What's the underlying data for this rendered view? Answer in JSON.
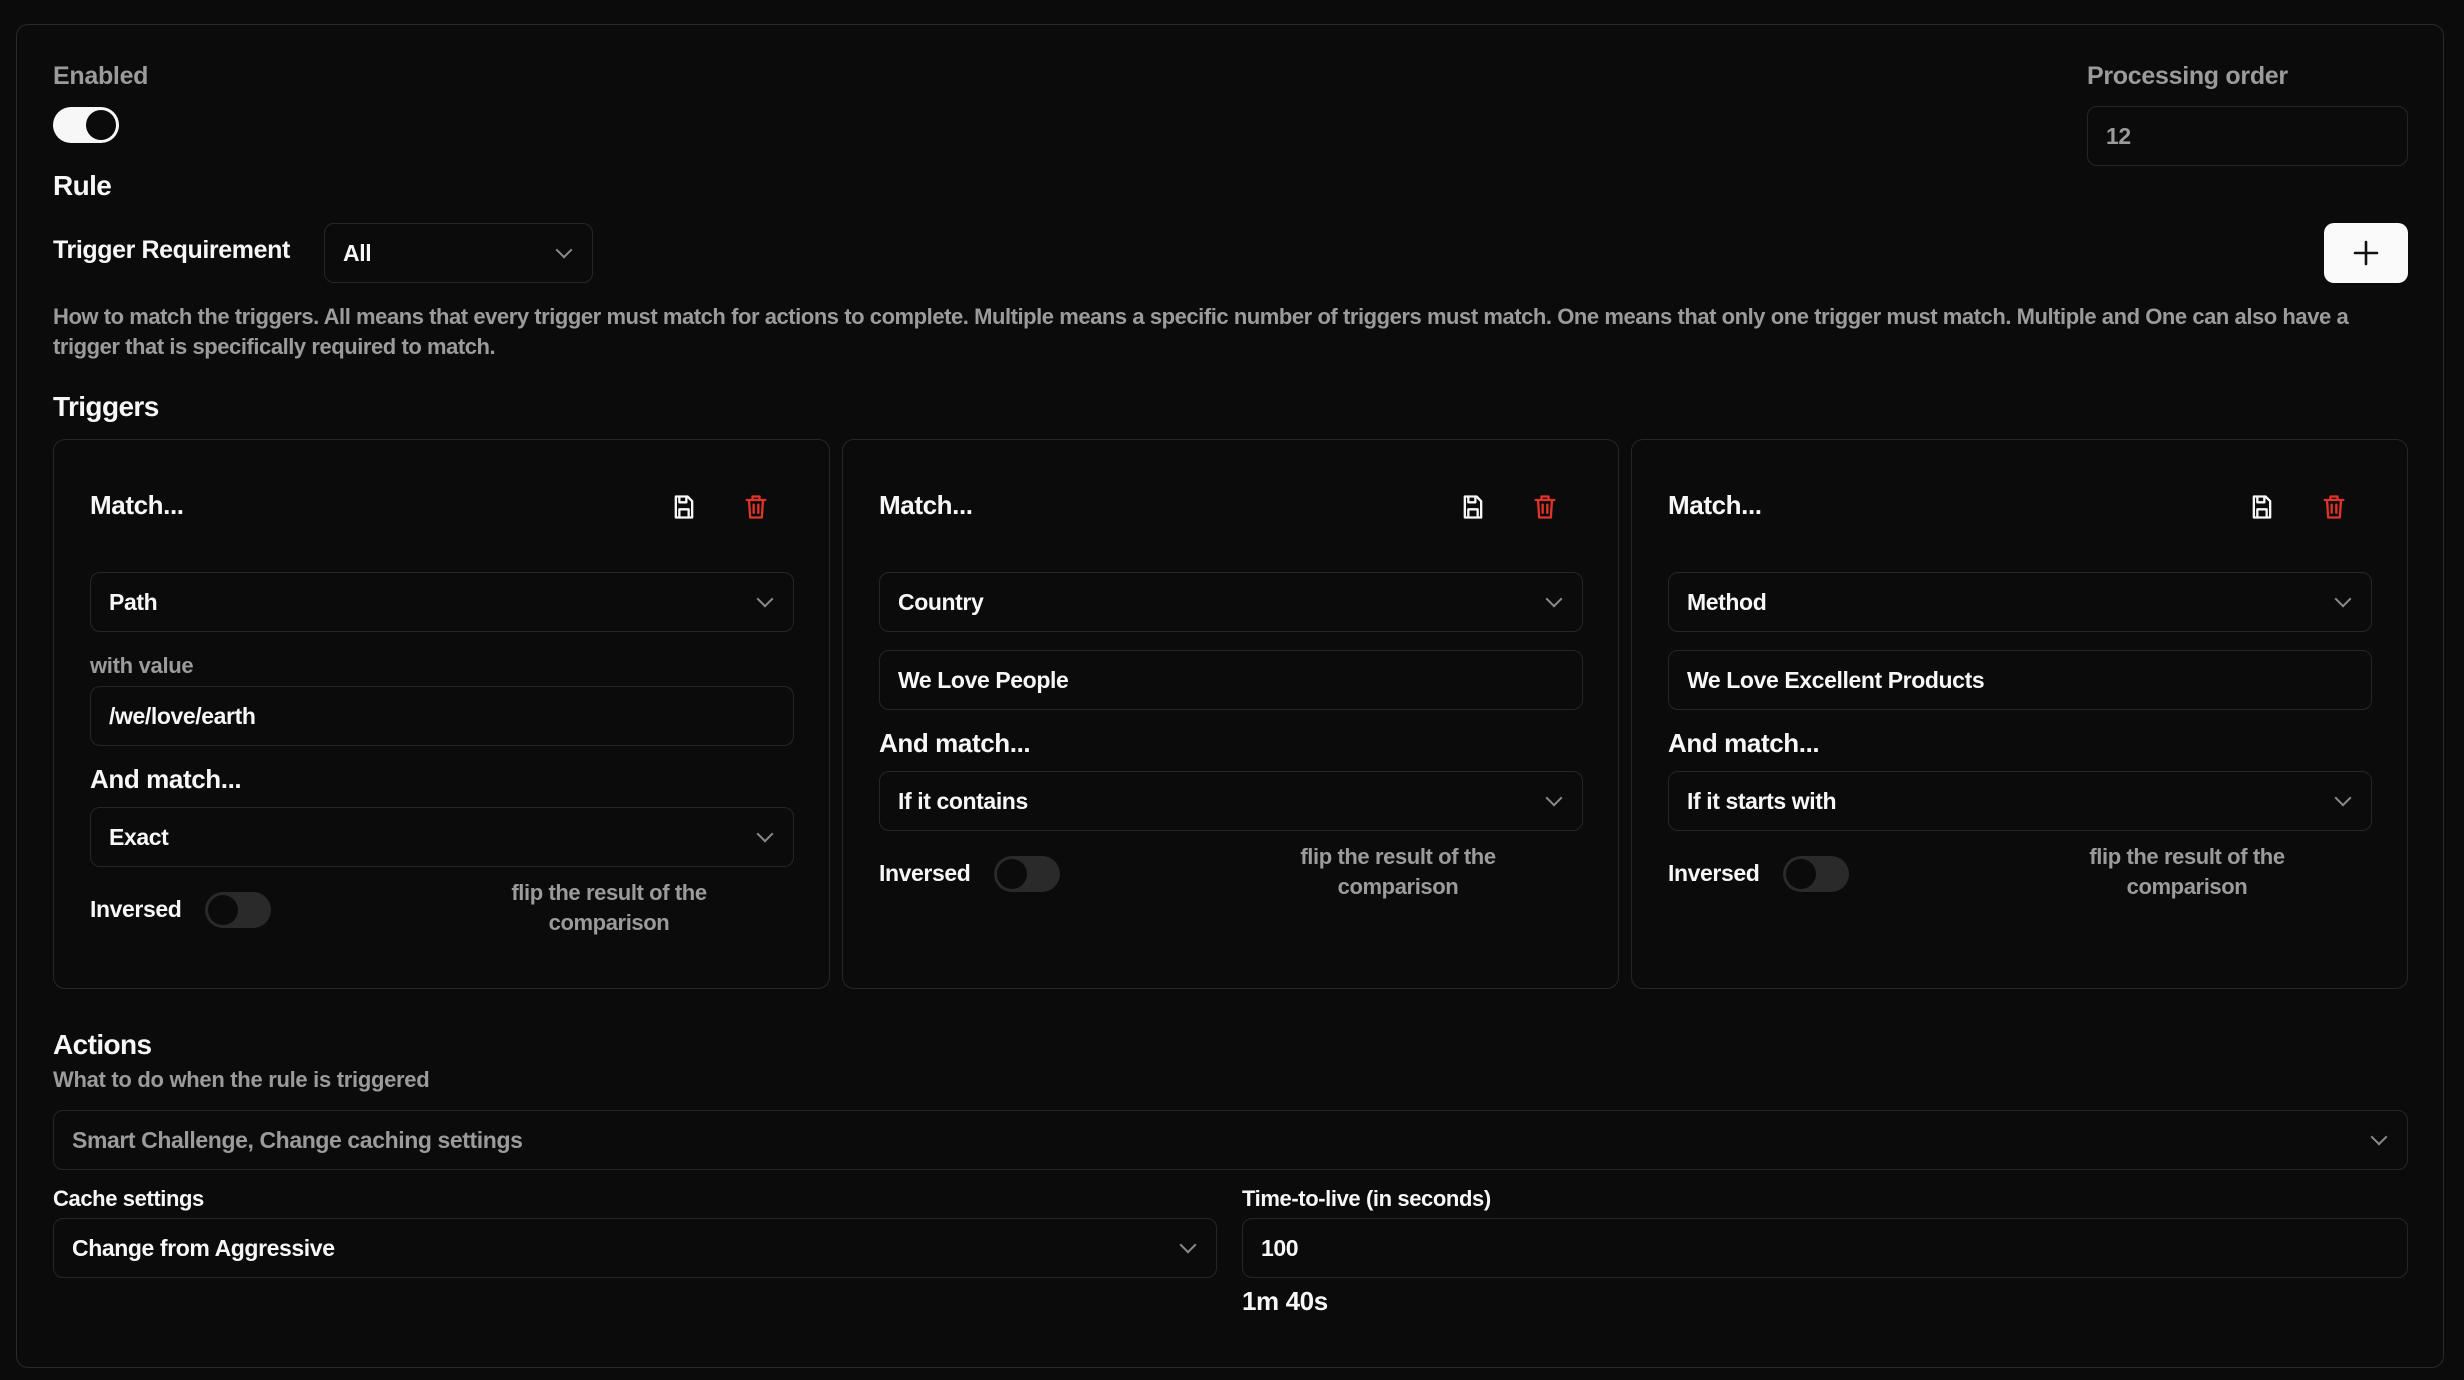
{
  "enabled": {
    "label": "Enabled",
    "value": true
  },
  "processing_order": {
    "label": "Processing order",
    "value": "12"
  },
  "rule": {
    "title": "Rule",
    "trigger_requirement": {
      "label": "Trigger Requirement",
      "value": "All"
    },
    "add_icon": "plus-icon",
    "description": "How to match the triggers. All means that every trigger must match for actions to complete. Multiple means a specific number of triggers must match. One means that only one trigger must match. Multiple and One can also have a trigger that is specifically required to match."
  },
  "triggers": {
    "title": "Triggers",
    "cards": [
      {
        "title": "Match...",
        "save_icon": "save-icon",
        "delete_icon": "trash-icon",
        "field": "Path",
        "value_label": "with value",
        "value": "/we/love/earth",
        "and_match_label": "And match...",
        "comparison": "Exact",
        "inversed_label": "Inversed",
        "inversed": false,
        "inversed_hint": "flip the result of the comparison"
      },
      {
        "title": "Match...",
        "save_icon": "save-icon",
        "delete_icon": "trash-icon",
        "field": "Country",
        "value": "We Love People",
        "and_match_label": "And match...",
        "comparison": "If it contains",
        "inversed_label": "Inversed",
        "inversed": false,
        "inversed_hint": "flip the result of the comparison"
      },
      {
        "title": "Match...",
        "save_icon": "save-icon",
        "delete_icon": "trash-icon",
        "field": "Method",
        "value": "We Love Excellent Products",
        "and_match_label": "And match...",
        "comparison": "If it starts with",
        "inversed_label": "Inversed",
        "inversed": false,
        "inversed_hint": "flip the result of the comparison"
      }
    ]
  },
  "actions": {
    "title": "Actions",
    "subtitle": "What to do when the rule is triggered",
    "selected": "Smart Challenge, Change caching settings",
    "cache_settings": {
      "label": "Cache settings",
      "value": "Change from Aggressive"
    },
    "ttl": {
      "label": "Time-to-live (in seconds)",
      "value": "100",
      "human": "1m 40s"
    }
  },
  "colors": {
    "background": "#0b0b0b",
    "border": "#262626",
    "text": "#f7f7f7",
    "muted": "#9b9b9b",
    "danger": "#e0342b",
    "button_bg": "#fafafa"
  }
}
